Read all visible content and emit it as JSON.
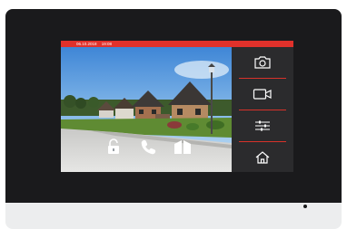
{
  "status_bar": {
    "date": "06.10.2018",
    "time": "19:08",
    "color": "#e0312b"
  },
  "video_feed": {
    "scene": "live-camera-feed"
  },
  "call_controls": [
    {
      "icon": "unlock-icon",
      "action": "unlock"
    },
    {
      "icon": "phone-icon",
      "action": "answer"
    },
    {
      "icon": "gate-icon",
      "action": "open-gate"
    }
  ],
  "side_panel": [
    {
      "icon": "camera-icon",
      "action": "snapshot"
    },
    {
      "icon": "video-camera-icon",
      "action": "record"
    },
    {
      "icon": "sliders-icon",
      "action": "settings"
    },
    {
      "icon": "home-icon",
      "action": "home"
    }
  ],
  "colors": {
    "bezel": "#1a1a1c",
    "base": "#ecedee",
    "panel": "#2b2b2d",
    "accent": "#e0312b"
  }
}
